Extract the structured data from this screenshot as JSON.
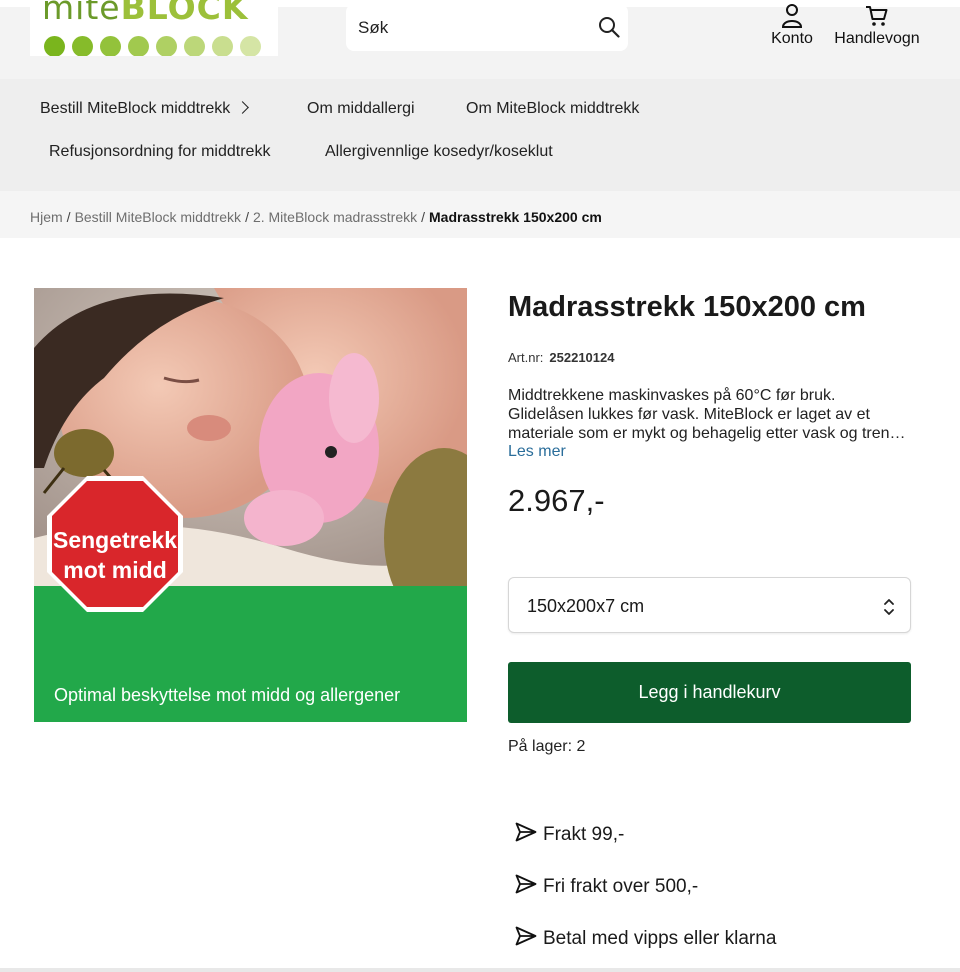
{
  "brand": {
    "logo_text_a": "mite",
    "logo_text_b": "BLOCK",
    "dot_colors": [
      "#7ab51d",
      "#86bb2a",
      "#93c23b",
      "#a1c94e",
      "#afd063",
      "#bcd779",
      "#c9de8f",
      "#d5e5a5"
    ]
  },
  "header": {
    "search_placeholder": "Søk",
    "account_label": "Konto",
    "cart_label": "Handlevogn"
  },
  "nav": {
    "items": [
      {
        "label": "Bestill MiteBlock middtrekk",
        "has_submenu": true
      },
      {
        "label": "Om middallergi"
      },
      {
        "label": "Om MiteBlock middtrekk"
      },
      {
        "label": "Refusjonsordning for middtrekk"
      },
      {
        "label": "Allergivennlige kosedyr/koseklut"
      }
    ]
  },
  "breadcrumb": {
    "items": [
      "Hjem",
      "Bestill MiteBlock middtrekk",
      "2. MiteBlock madrasstrekk"
    ],
    "separator": "/",
    "current": "Madrasstrekk 150x200 cm"
  },
  "image": {
    "badge_line1": "Sengetrekk",
    "badge_line2": "mot midd",
    "caption": "Optimal beskyttelse mot midd og allergener",
    "green": "#22a84a",
    "stop_red": "#d9262b"
  },
  "product": {
    "title": "Madrasstrekk 150x200 cm",
    "artnr_label": "Art.nr:",
    "artnr_value": "252210124",
    "description_lines": [
      "Middtrekkene maskinvaskes på 60°C før bruk.",
      "Glidelåsen lukkes før vask. MiteBlock er laget av et",
      "materiale som er mykt og behagelig etter vask og tren…"
    ],
    "read_more": "Les mer",
    "price": "2.967,-",
    "variant_selected": "150x200x7 cm",
    "add_to_cart": "Legg i handlekurv",
    "stock": "På lager: 2",
    "accent_color": "#0d5d2c",
    "link_color": "#2a6d9a"
  },
  "usps": [
    {
      "icon": "send-icon",
      "text": "Frakt 99,-"
    },
    {
      "icon": "send-icon",
      "text": "Fri frakt over 500,-"
    },
    {
      "icon": "send-icon",
      "text": "Betal med vipps eller klarna"
    }
  ]
}
